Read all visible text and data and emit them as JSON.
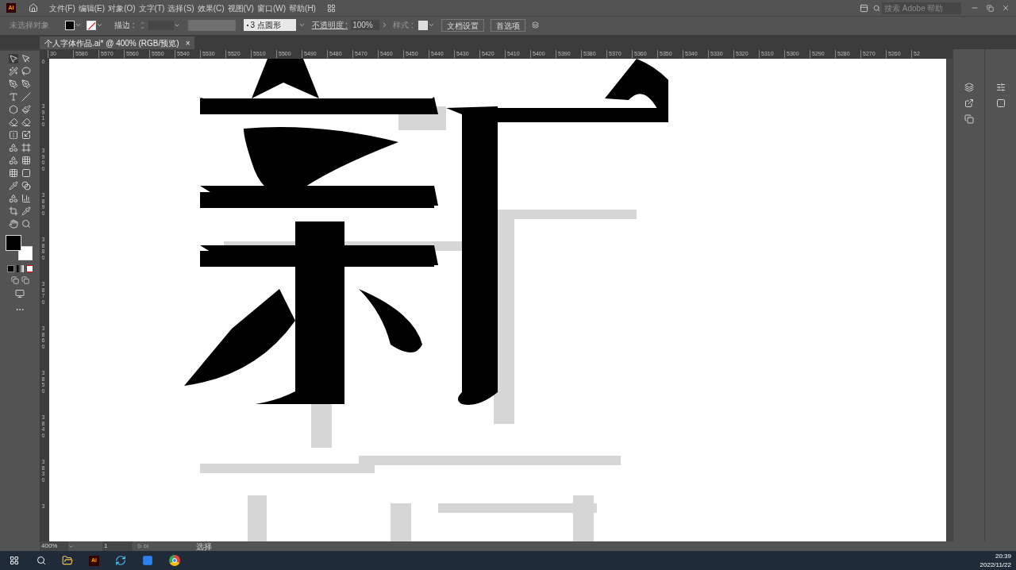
{
  "app_icon": "Ai",
  "menu": [
    "文件(F)",
    "编辑(E)",
    "对象(O)",
    "文字(T)",
    "选择(S)",
    "效果(C)",
    "视图(V)",
    "窗口(W)",
    "帮助(H)"
  ],
  "search": {
    "placeholder": "搜索 Adobe 帮助"
  },
  "control_bar": {
    "selection": "未选择对象",
    "stroke_label": "描边 :",
    "brush": "3 点圆形",
    "opacity_label": "不透明度 :",
    "opacity": "100%",
    "style_label": "样式 :",
    "buttons": [
      "文档设置",
      "首选项"
    ]
  },
  "tabs": [
    {
      "label": "个人字体作品.ai* @ 400% (RGB/预览)",
      "selected": true,
      "close": "×"
    }
  ],
  "ruler_h": [
    "30",
    "5580",
    "5570",
    "5560",
    "5550",
    "5540",
    "5530",
    "5520",
    "5510",
    "5500",
    "5490",
    "5480",
    "5470",
    "5460",
    "5450",
    "5440",
    "5430",
    "5420",
    "5410",
    "5400",
    "5390",
    "5380",
    "5370",
    "5360",
    "5350",
    "5340",
    "5330",
    "5320",
    "5310",
    "5300",
    "5290",
    "5280",
    "5270",
    "5260",
    "52"
  ],
  "ruler_v": [
    "0",
    "3910",
    "3900",
    "3890",
    "3880",
    "3870",
    "3860",
    "3850",
    "3840",
    "3830",
    "3"
  ],
  "status_bar": {
    "zoom": "400%",
    "artboard": "1",
    "tool": "选择"
  },
  "taskbar": {
    "app_label": "Ai",
    "time": "20:39",
    "date": "2022/11/22"
  }
}
